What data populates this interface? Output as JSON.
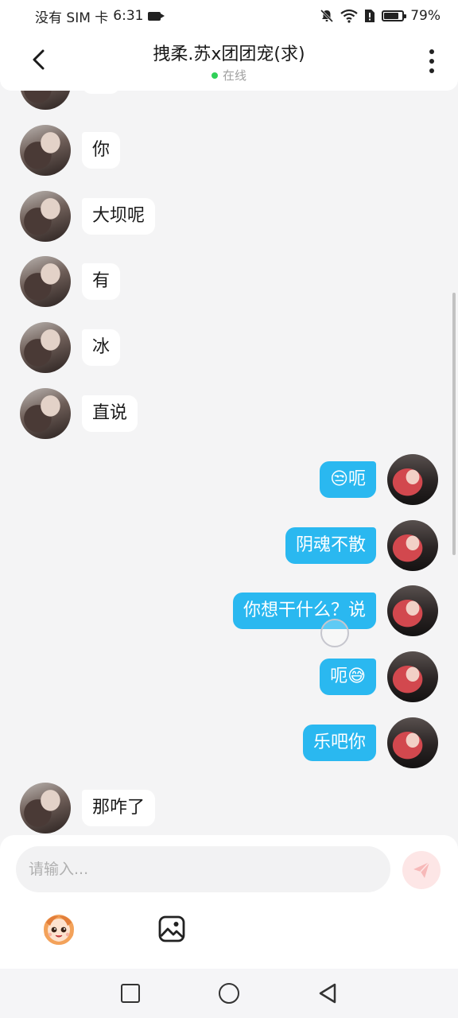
{
  "status_bar": {
    "carrier": "没有 SIM 卡",
    "time": "6:31",
    "battery_percent": "79%",
    "battery_level": 0.79
  },
  "header": {
    "title": "拽柔.苏x团团宠(求)",
    "online_label": "在线"
  },
  "messages": [
    {
      "side": "left",
      "text": "你"
    },
    {
      "side": "left",
      "text": "大坝呢"
    },
    {
      "side": "left",
      "text": "有"
    },
    {
      "side": "left",
      "text": "冰"
    },
    {
      "side": "left",
      "text": "直说"
    },
    {
      "side": "right",
      "text": "😒呃"
    },
    {
      "side": "right",
      "text": "阴魂不散"
    },
    {
      "side": "right",
      "text": "你想干什么？说"
    },
    {
      "side": "right",
      "text": "呃😅"
    },
    {
      "side": "right",
      "text": "乐吧你"
    },
    {
      "side": "left",
      "text": "那咋了"
    }
  ],
  "composer": {
    "placeholder": "请输入..."
  },
  "icons": {
    "back": "chevron-left-icon",
    "more": "more-vertical-icon",
    "send": "send-icon",
    "emoji": "emoji-sticker-icon",
    "image": "image-icon"
  },
  "colors": {
    "accent": "#2ab8f0",
    "online": "#2fd058",
    "send_disabled": "#fde6e6"
  }
}
